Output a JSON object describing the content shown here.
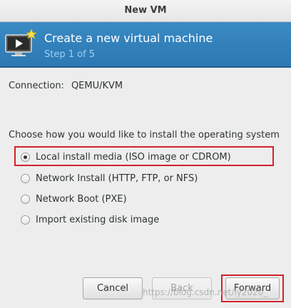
{
  "window": {
    "title": "New VM"
  },
  "header": {
    "title": "Create a new virtual machine",
    "step": "Step 1 of 5",
    "icon": "monitor-play-star-icon"
  },
  "connection": {
    "label": "Connection:",
    "value": "QEMU/KVM"
  },
  "install": {
    "prompt": "Choose how you would like to install the operating system",
    "options": [
      {
        "label": "Local install media (ISO image or CDROM)",
        "selected": true
      },
      {
        "label": "Network Install (HTTP, FTP, or NFS)",
        "selected": false
      },
      {
        "label": "Network Boot (PXE)",
        "selected": false
      },
      {
        "label": "Import existing disk image",
        "selected": false
      }
    ]
  },
  "buttons": {
    "cancel": "Cancel",
    "back": "Back",
    "forward": "Forward"
  },
  "watermark": "https://blog.csdn.net/ly2020_",
  "colors": {
    "header_bg": "#2f7db7",
    "highlight": "#d2232a"
  }
}
